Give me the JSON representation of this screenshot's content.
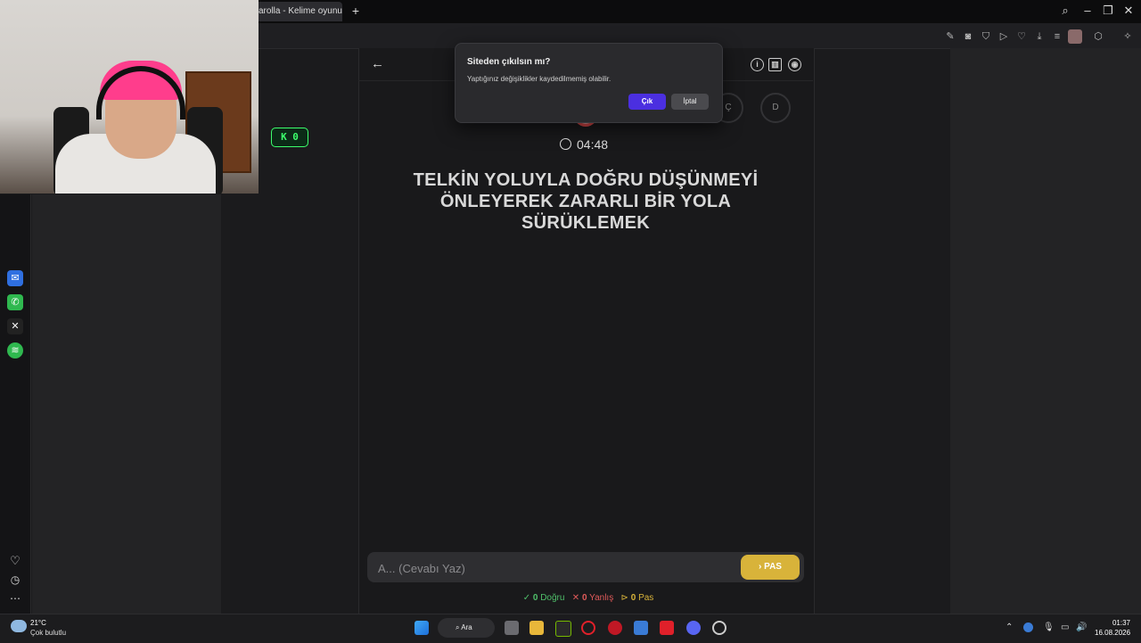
{
  "browser": {
    "tab_title": "arolla - Kelime oyunu. G",
    "new_tab": "+",
    "window_controls": [
      "search-icon",
      "minimize-icon",
      "restore-icon",
      "close-icon"
    ]
  },
  "stream": {
    "kick_badge": "K 0"
  },
  "dialog": {
    "title": "Siteden çıkılsın mı?",
    "message": "Yaptığınız değişiklikler kaydedilmemiş olabilir.",
    "confirm_label": "Çık",
    "cancel_label": "İptal"
  },
  "game": {
    "letters": [
      "Ç",
      "D"
    ],
    "timer": "04:48",
    "question": "TELKİN YOLUYLA DOĞRU DÜŞÜNMEYİ ÖNLEYEREK ZARARLI BİR YOLA SÜRÜKLEMEK",
    "answer_placeholder": "A... (Cevabı Yaz)",
    "pass_label": "PAS",
    "stats": {
      "correct_count": "0",
      "correct_label": "Doğru",
      "wrong_count": "0",
      "wrong_label": "Yanlış",
      "pass_count": "0",
      "pass_label": "Pas"
    }
  },
  "taskbar": {
    "temperature": "21°C",
    "weather": "Çok bulutlu",
    "search_label": "Ara",
    "time": "01:37",
    "date": "16.08.2026"
  },
  "colors": {
    "accent": "#4b2fe0",
    "pass_button": "#d8b33a",
    "correct": "#4fbf6a",
    "wrong": "#e05a5a",
    "kick_green": "#3cff6c"
  }
}
